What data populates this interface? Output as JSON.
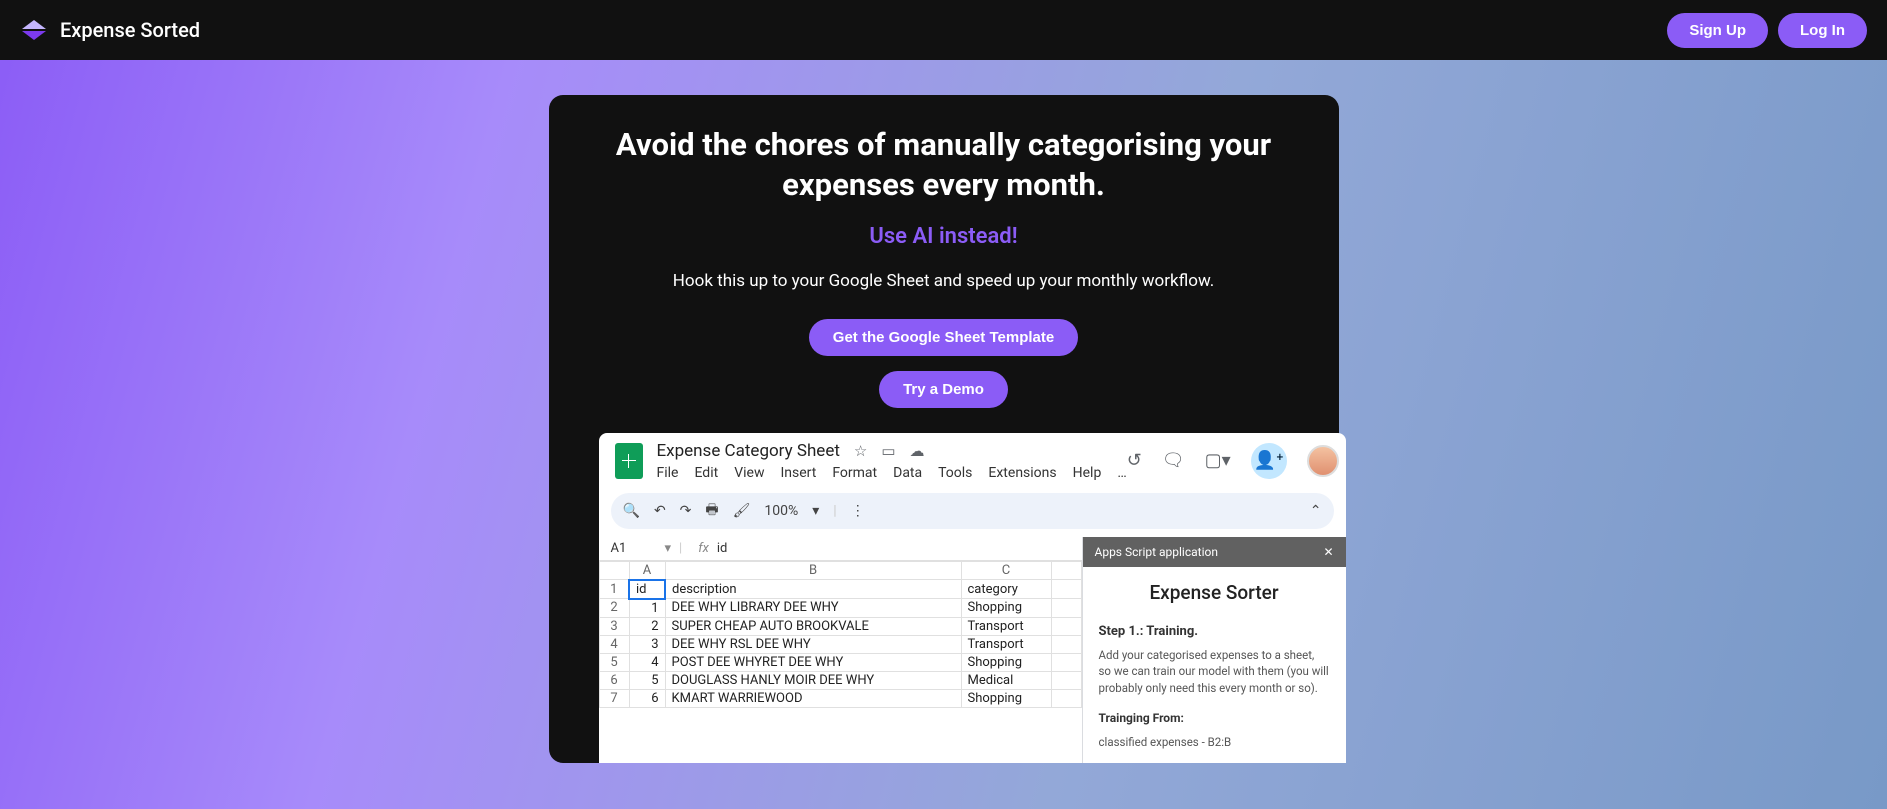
{
  "nav": {
    "brand": "Expense Sorted",
    "signup": "Sign Up",
    "login": "Log In"
  },
  "hero": {
    "headline": "Avoid the chores of manually categorising your expenses every month.",
    "subhead": "Use AI instead!",
    "tagline": "Hook this up to your Google Sheet and speed up your monthly workflow.",
    "cta_template": "Get the Google Sheet Template",
    "cta_demo": "Try a Demo"
  },
  "sheet": {
    "title": "Expense Category Sheet",
    "menus": [
      "File",
      "Edit",
      "View",
      "Insert",
      "Format",
      "Data",
      "Tools",
      "Extensions",
      "Help",
      "…"
    ],
    "zoom": "100%",
    "cellref": "A1",
    "fx_value": "id",
    "columns": [
      "",
      "A",
      "B",
      "C"
    ],
    "headers": {
      "a": "id",
      "b": "description",
      "c": "category"
    },
    "rows": [
      {
        "n": "1",
        "a": "id",
        "b": "description",
        "c": "category"
      },
      {
        "n": "2",
        "a": "1",
        "b": "DEE WHY LIBRARY DEE WHY",
        "c": "Shopping"
      },
      {
        "n": "3",
        "a": "2",
        "b": "SUPER CHEAP AUTO BROOKVALE",
        "c": "Transport"
      },
      {
        "n": "4",
        "a": "3",
        "b": "DEE WHY RSL DEE WHY",
        "c": "Transport"
      },
      {
        "n": "5",
        "a": "4",
        "b": "POST DEE WHYRET DEE WHY",
        "c": "Shopping"
      },
      {
        "n": "6",
        "a": "5",
        "b": "DOUGLASS HANLY MOIR DEE WHY",
        "c": "Medical"
      },
      {
        "n": "7",
        "a": "6",
        "b": "KMART WARRIEWOOD",
        "c": "Shopping"
      }
    ]
  },
  "sidebar": {
    "header": "Apps Script application",
    "title": "Expense Sorter",
    "step_title": "Step 1.: Training.",
    "step_body": "Add your categorised expenses to a sheet, so we can train our model with them (you will probably only need this every month or so).",
    "train_label": "Trainging From:",
    "train_value": "classified expenses - B2:B"
  }
}
